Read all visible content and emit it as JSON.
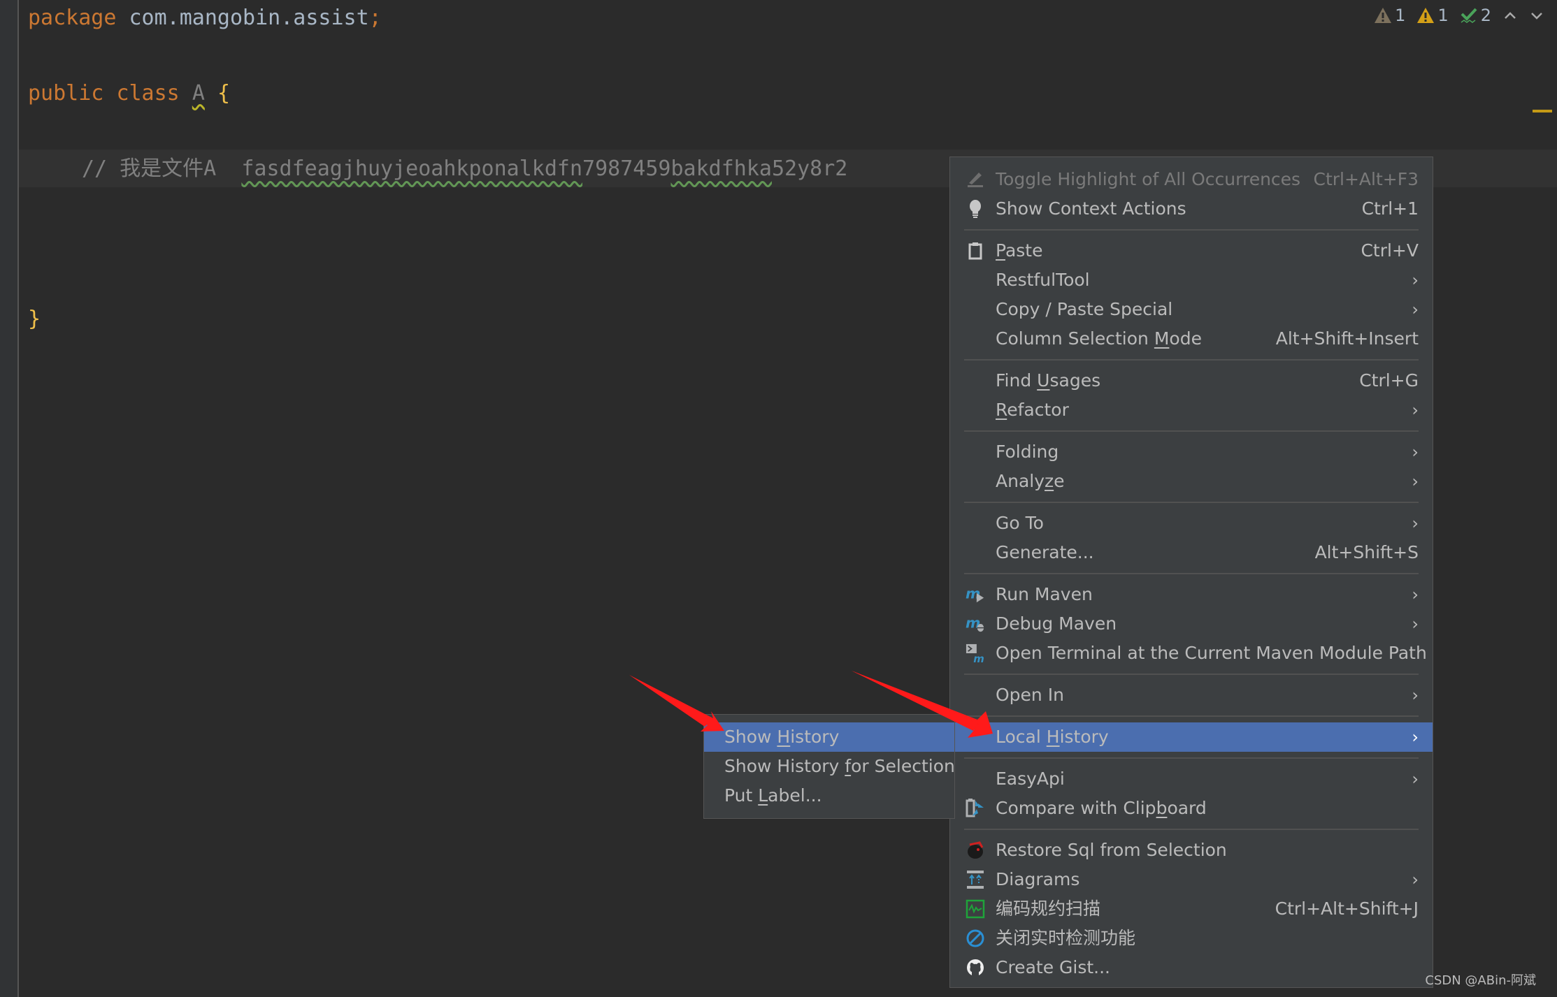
{
  "editor": {
    "lines": {
      "package_kw": "package",
      "package_name": "com.mangobin.assist",
      "package_semi": ";",
      "public_kw": "public",
      "class_kw": "class",
      "class_name": "A",
      "open_brace": "{",
      "comment_prefix": "// 我是文件A  ",
      "comment_typo1": "fasdfeagjhuyjeoahkponalkdfn",
      "comment_plain": "7987459",
      "comment_typo2": "bakdfhka",
      "comment_tail": "52y8r2",
      "close_brace": "}"
    }
  },
  "inspections": {
    "weak_warnings": "1",
    "warnings": "1",
    "typos": "2"
  },
  "context_menu": {
    "items": [
      {
        "label": "Toggle Highlight of All Occurrences",
        "shortcut": "Ctrl+Alt+F3",
        "icon": "highlight-icon",
        "disabled": true
      },
      {
        "label": "Show Context Actions",
        "shortcut": "Ctrl+1",
        "icon": "lightbulb-icon"
      },
      {
        "label": "Paste",
        "shortcut": "Ctrl+V",
        "icon": "clipboard-icon",
        "mnemonic": "P"
      },
      {
        "label": "RestfulTool",
        "submenu": true
      },
      {
        "label": "Copy / Paste Special",
        "submenu": true
      },
      {
        "label": "Column Selection Mode",
        "shortcut": "Alt+Shift+Insert",
        "mnemonic": "M"
      },
      {
        "label": "Find Usages",
        "shortcut": "Ctrl+G",
        "mnemonic": "U"
      },
      {
        "label": "Refactor",
        "submenu": true,
        "mnemonic": "R"
      },
      {
        "label": "Folding",
        "submenu": true
      },
      {
        "label": "Analyze",
        "submenu": true,
        "mnemonic": "z"
      },
      {
        "label": "Go To",
        "submenu": true
      },
      {
        "label": "Generate...",
        "shortcut": "Alt+Shift+S"
      },
      {
        "label": "Run Maven",
        "submenu": true,
        "icon": "maven-run-icon"
      },
      {
        "label": "Debug Maven",
        "submenu": true,
        "icon": "maven-debug-icon"
      },
      {
        "label": "Open Terminal at the Current Maven Module Path",
        "icon": "maven-terminal-icon"
      },
      {
        "label": "Open In",
        "submenu": true
      },
      {
        "label": "Local History",
        "submenu": true,
        "selected": true,
        "mnemonic": "H"
      },
      {
        "label": "EasyApi",
        "submenu": true
      },
      {
        "label": "Compare with Clipboard",
        "icon": "compare-clipboard-icon",
        "mnemonic": "b"
      },
      {
        "label": "Restore Sql from Selection",
        "icon": "restore-sql-icon"
      },
      {
        "label": "Diagrams",
        "submenu": true,
        "icon": "diagrams-icon"
      },
      {
        "label": "编码规约扫描",
        "shortcut": "Ctrl+Alt+Shift+J",
        "icon": "code-scan-icon"
      },
      {
        "label": "关闭实时检测功能",
        "icon": "disable-icon"
      },
      {
        "label": "Create Gist...",
        "icon": "github-icon"
      }
    ],
    "submenu_arrow": "›"
  },
  "local_history_submenu": {
    "items": [
      {
        "label": "Show History",
        "selected": true,
        "mnemonic": "H"
      },
      {
        "label": "Show History for Selection",
        "mnemonic": "f"
      },
      {
        "label": "Put Label...",
        "mnemonic": "L"
      }
    ]
  },
  "watermark": "CSDN @ABin-阿斌",
  "colors": {
    "editor_bg": "#2b2b2b",
    "menu_bg": "#3c3f41",
    "selection": "#4b6eaf",
    "keyword": "#cc7832",
    "annotation_arrow": "#ff1a1a"
  }
}
